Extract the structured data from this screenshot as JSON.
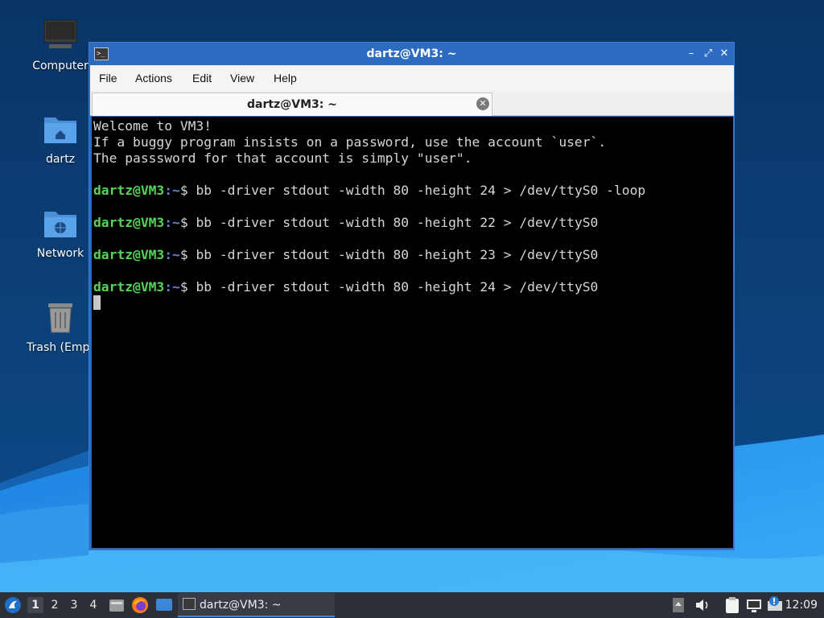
{
  "desktop": {
    "icons": [
      {
        "label": "Computer",
        "icon": "computer-icon"
      },
      {
        "label": "dartz",
        "icon": "home-folder-icon"
      },
      {
        "label": "Network",
        "icon": "network-folder-icon"
      },
      {
        "label": "Trash (Empt",
        "icon": "trash-icon"
      }
    ]
  },
  "window": {
    "title": "dartz@VM3: ~",
    "menu": [
      "File",
      "Actions",
      "Edit",
      "View",
      "Help"
    ],
    "tab_label": "dartz@VM3: ~"
  },
  "terminal": {
    "motd": [
      "Welcome to VM3!",
      "If a buggy program insists on a password, use the account `user`.",
      "The passsword for that account is simply \"user\"."
    ],
    "prompt_user": "dartz@VM3",
    "prompt_path": ":~",
    "prompt_dollar": "$ ",
    "commands": [
      "bb -driver stdout -width 80 -height 24 > /dev/ttyS0 -loop",
      "bb -driver stdout -width 80 -height 22 > /dev/ttyS0",
      "bb -driver stdout -width 80 -height 23 > /dev/ttyS0",
      "bb -driver stdout -width 80 -height 24 > /dev/ttyS0"
    ]
  },
  "taskbar": {
    "workspaces": [
      "1",
      "2",
      "3",
      "4"
    ],
    "task_label": "dartz@VM3: ~",
    "clock": "12:09",
    "launchers": [
      "file-manager-icon",
      "firefox-icon",
      "show-desktop-icon"
    ],
    "tray": [
      "tray-scroll-icon",
      "volume-icon",
      "clipboard-icon",
      "network-icon",
      "update-notifier-icon"
    ]
  },
  "colors": {
    "window_frame": "#2d6bc0",
    "terminal_bg": "#000000",
    "prompt_user": "#55d455",
    "prompt_path": "#6b86d8",
    "taskbar_bg": "#2b2f36"
  }
}
